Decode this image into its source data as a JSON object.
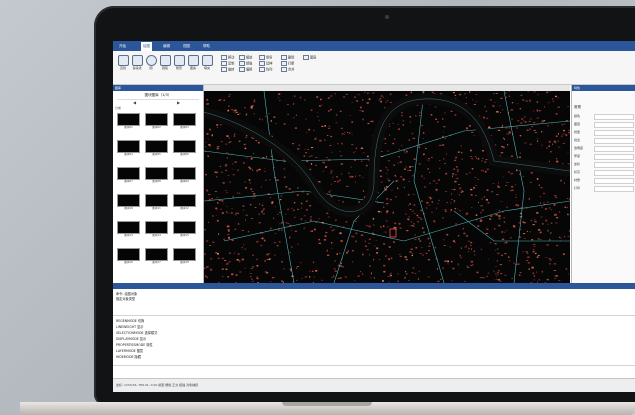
{
  "ribbon": {
    "tabs": [
      "开始",
      "绘图",
      "编辑",
      "视图",
      "帮助"
    ],
    "active_tab": 1,
    "big_buttons": [
      "直线",
      "多段线",
      "圆",
      "圆弧",
      "矩形",
      "图案",
      "填充"
    ],
    "small_buttons": [
      "移动",
      "复制",
      "旋转",
      "缩放",
      "镜像",
      "偏移",
      "修剪",
      "延伸",
      "阵列",
      "删除",
      "打断",
      "合并",
      "图层"
    ]
  },
  "left_panel": {
    "header": "图库",
    "title": "图块图库（1/3）",
    "prev": "◀",
    "next": "▶",
    "subtitle": "分类",
    "items": [
      "图块01",
      "图块02",
      "图块03",
      "图块04",
      "图块05",
      "图块06",
      "图块07",
      "图块08",
      "图块09",
      "图块10",
      "图块11",
      "图块12",
      "图块13",
      "图块14",
      "图块15",
      "图块16",
      "图块17",
      "图块18"
    ]
  },
  "map": {
    "tab": "模型"
  },
  "right_panel": {
    "header": "特性",
    "title": "常规",
    "rows": [
      "颜色",
      "图层",
      "线型",
      "线宽",
      "透明度",
      "厚度",
      "坐标",
      "标高",
      "材质",
      "打印"
    ]
  },
  "command": {
    "lines": [
      "命令: 绘图对象",
      "指定对象类型",
      "REGENMODE 切换",
      "LINEWEIGHT 显示",
      "SELECTIONMODE 选择模式",
      "DISPLAYMODE 显示",
      "PROPERTIESMODE 特性",
      "LAYERMODE 图层",
      "HIDEMODE 隐藏"
    ],
    "status": "坐标: 1234.56, 789.01, 0.00  模型  栅格  正交  极轴  对象捕捉"
  },
  "colors": {
    "ribbon_blue": "#2b579a",
    "map_background": "#000000",
    "river": "#0d0d0d",
    "roads_cyan": "#5fd3d6",
    "buildings_red": "#e05a4a"
  }
}
